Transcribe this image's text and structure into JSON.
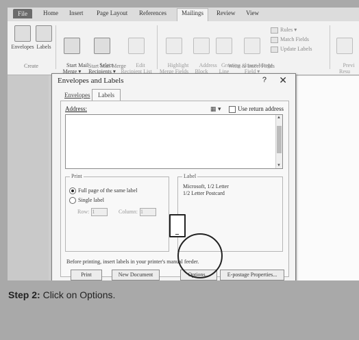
{
  "ribbon": {
    "tabs": [
      "File",
      "Home",
      "Insert",
      "Page Layout",
      "References",
      "Mailings",
      "Review",
      "View"
    ],
    "active_tab": "Mailings",
    "buttons": {
      "envelopes": "Envelopes",
      "labels": "Labels",
      "start_mail_merge": "Start Mail\nMerge ▾",
      "select_recipients": "Select\nRecipients ▾",
      "edit_recipient_list": "Edit\nRecipient List",
      "highlight_merge_fields": "Highlight\nMerge Fields",
      "address_block": "Address\nBlock",
      "greeting_line": "Greeting\nLine",
      "insert_merge_field": "Insert Merge\nField ▾",
      "rules": "Rules ▾",
      "match_fields": "Match Fields",
      "update_labels": "Update Labels",
      "preview_results": "Previ\nResu"
    },
    "groups": {
      "create": "Create",
      "start_mail_merge": "Start Mail Merge",
      "write_insert_fields": "Write & Insert Fields"
    }
  },
  "dialog": {
    "title": "Envelopes and Labels",
    "help": "?",
    "close": "✕",
    "tabs": {
      "envelopes": "Envelopes",
      "labels": "Labels"
    },
    "address_label": "Address:",
    "address_icon": "▦ ▾",
    "use_return_address": "Use return address",
    "print_group": "Print",
    "full_page": "Full page of the same label",
    "single_label": "Single label",
    "row_label": "Row:",
    "row_value": "1",
    "column_label": "Column:",
    "column_value": "1",
    "label_group": "Label",
    "label_line1": "Microsoft, 1/2 Letter",
    "label_line2": "1/2 Letter Postcard",
    "note": "Before printing, insert labels in your printer's manual feeder.",
    "buttons": {
      "print": "Print",
      "new_document": "New Document",
      "options": "Options...",
      "epostage": "E-postage Properties..."
    }
  },
  "caption": {
    "step": "Step 2:",
    "text": " Click on Options."
  }
}
